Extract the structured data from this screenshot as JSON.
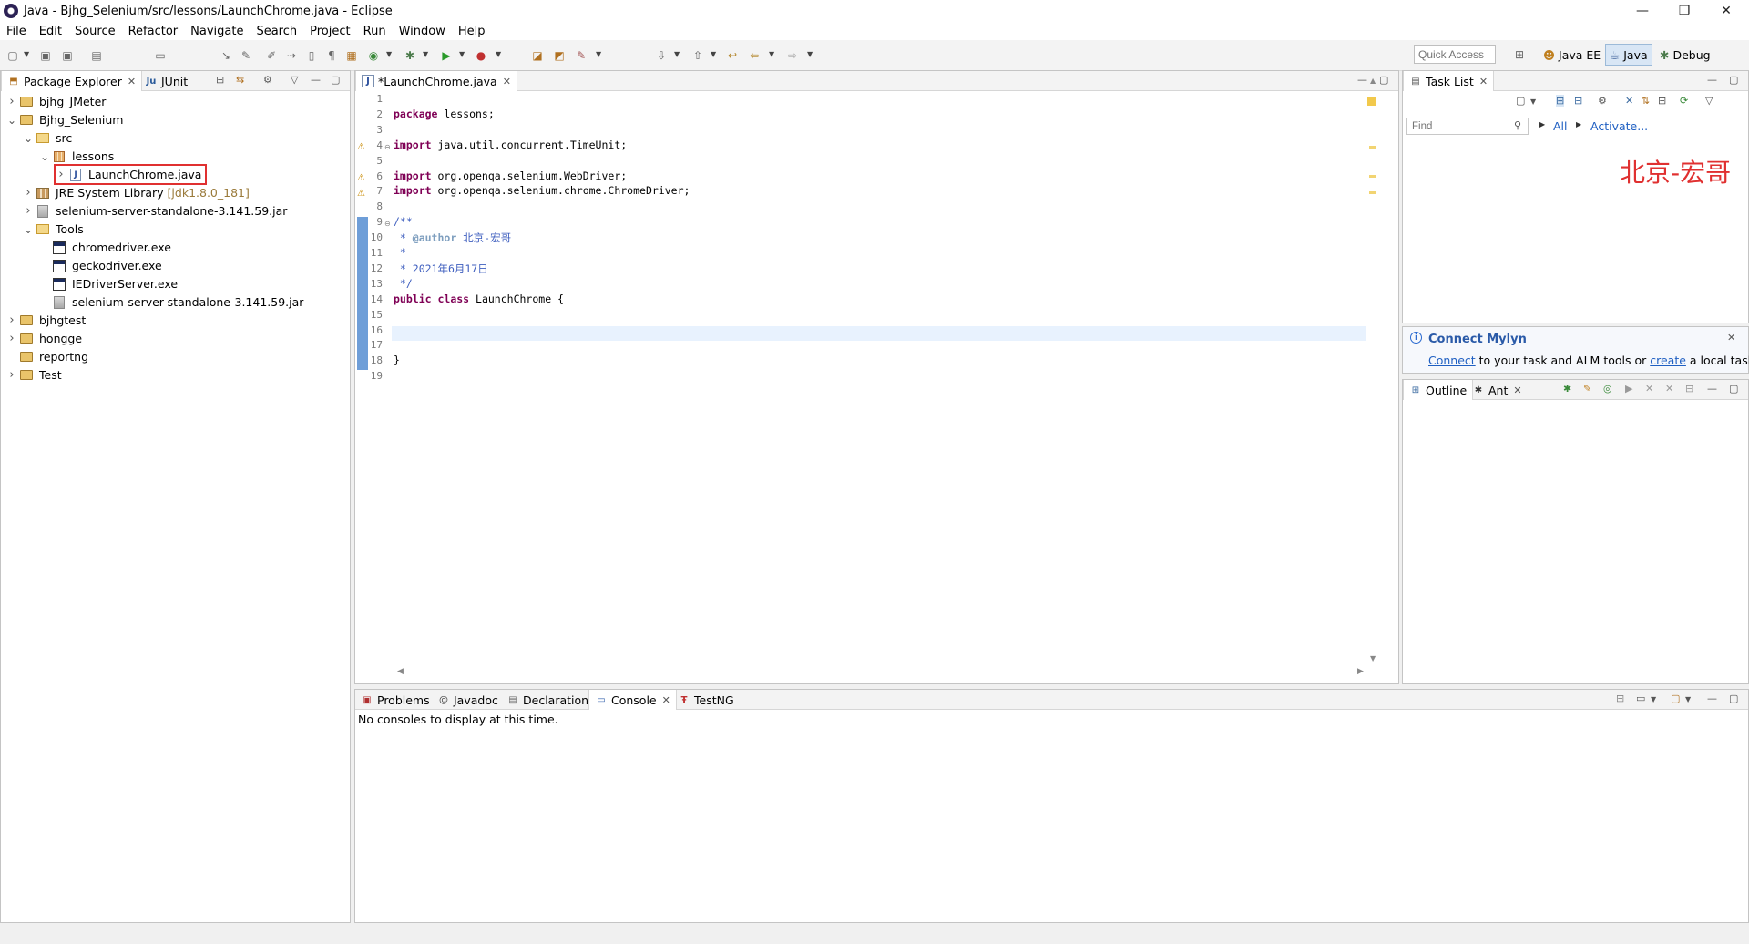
{
  "window": {
    "title": "Java - Bjhg_Selenium/src/lessons/LaunchChrome.java - Eclipse",
    "minimize": "—",
    "restore": "❐",
    "close": "✕"
  },
  "menu": [
    "File",
    "Edit",
    "Source",
    "Refactor",
    "Navigate",
    "Search",
    "Project",
    "Run",
    "Window",
    "Help"
  ],
  "toolbar": {
    "quick_access": "Quick Access",
    "perspectives": [
      {
        "label": "Java EE",
        "active": false
      },
      {
        "label": "Java",
        "active": true
      },
      {
        "label": "Debug",
        "active": false
      }
    ]
  },
  "package_explorer": {
    "tabs": [
      "Package Explorer",
      "JUnit"
    ],
    "tree": [
      {
        "label": "bjhg_JMeter",
        "level": 0,
        "expanded": false,
        "icon": "project-icon"
      },
      {
        "label": "Bjhg_Selenium",
        "level": 0,
        "expanded": true,
        "icon": "project-icon"
      },
      {
        "label": "src",
        "level": 1,
        "expanded": true,
        "icon": "source-folder-icon"
      },
      {
        "label": "lessons",
        "level": 2,
        "expanded": true,
        "icon": "package-icon"
      },
      {
        "label": "LaunchChrome.java",
        "level": 3,
        "expanded": false,
        "icon": "java-file-icon",
        "highlighted": true
      },
      {
        "label": "JRE System Library",
        "suffix": "[jdk1.8.0_181]",
        "level": 1,
        "expanded": false,
        "icon": "library-icon"
      },
      {
        "label": "selenium-server-standalone-3.141.59.jar",
        "level": 1,
        "expanded": false,
        "icon": "jar-icon"
      },
      {
        "label": "Tools",
        "level": 1,
        "expanded": true,
        "icon": "folder-icon"
      },
      {
        "label": "chromedriver.exe",
        "level": 2,
        "icon": "exe-icon"
      },
      {
        "label": "geckodriver.exe",
        "level": 2,
        "icon": "exe-icon"
      },
      {
        "label": "IEDriverServer.exe",
        "level": 2,
        "icon": "exe-icon"
      },
      {
        "label": "selenium-server-standalone-3.141.59.jar",
        "level": 2,
        "icon": "jar-icon"
      },
      {
        "label": "bjhgtest",
        "level": 0,
        "expanded": false,
        "icon": "project-icon"
      },
      {
        "label": "hongge",
        "level": 0,
        "expanded": false,
        "icon": "project-icon"
      },
      {
        "label": "reportng",
        "level": 0,
        "icon": "project-icon"
      },
      {
        "label": "Test",
        "level": 0,
        "expanded": false,
        "icon": "project-icon"
      }
    ]
  },
  "editor": {
    "tab": "*LaunchChrome.java",
    "lines": [
      {
        "n": "1",
        "t": ""
      },
      {
        "n": "2",
        "t": "package lessons;"
      },
      {
        "n": "3",
        "t": ""
      },
      {
        "n": "4",
        "t": "import java.util.concurrent.TimeUnit;"
      },
      {
        "n": "5",
        "t": ""
      },
      {
        "n": "6",
        "t": "import org.openqa.selenium.WebDriver;"
      },
      {
        "n": "7",
        "t": "import org.openqa.selenium.chrome.ChromeDriver;"
      },
      {
        "n": "8",
        "t": ""
      },
      {
        "n": "9",
        "t": "/**"
      },
      {
        "n": "10",
        "t": " * @author 北京-宏哥"
      },
      {
        "n": "11",
        "t": " *"
      },
      {
        "n": "12",
        "t": " * 2021年6月17日"
      },
      {
        "n": "13",
        "t": " */"
      },
      {
        "n": "14",
        "t": "public class LaunchChrome {"
      },
      {
        "n": "15",
        "t": ""
      },
      {
        "n": "16",
        "t": ""
      },
      {
        "n": "17",
        "t": ""
      },
      {
        "n": "18",
        "t": "}"
      },
      {
        "n": "19",
        "t": ""
      }
    ]
  },
  "task_list": {
    "tab": "Task List",
    "find_placeholder": "Find",
    "all": "All",
    "activate": "Activate...",
    "annotation": "北京-宏哥"
  },
  "mylyn": {
    "title": "Connect Mylyn",
    "connect": "Connect",
    "text1": " to your task and ALM tools or ",
    "create": "create",
    "text2": " a local task."
  },
  "outline": {
    "tabs": [
      "Outline",
      "Ant"
    ]
  },
  "bottom": {
    "tabs": [
      "Problems",
      "Javadoc",
      "Declaration",
      "Console",
      "TestNG"
    ],
    "message": "No consoles to display at this time."
  }
}
